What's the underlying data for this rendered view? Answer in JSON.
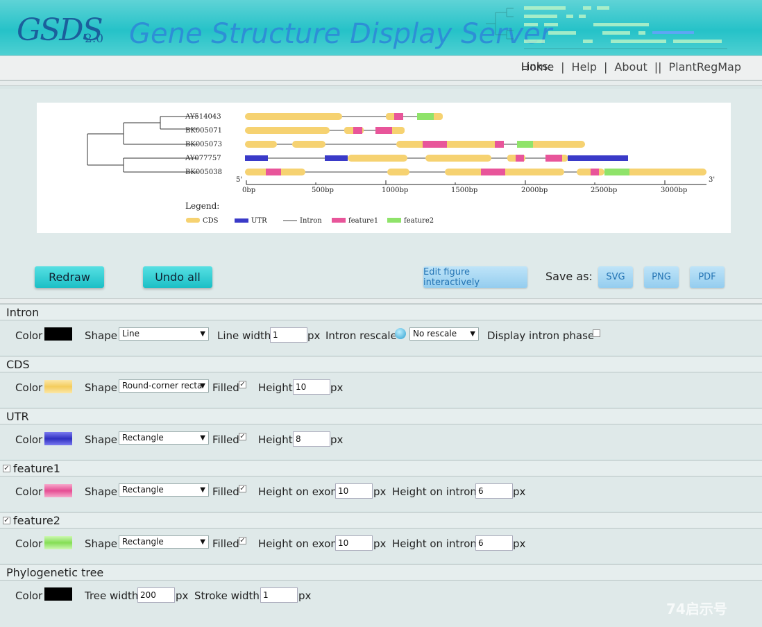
{
  "header": {
    "logo_text": "GSDS",
    "logo_version": "2.0",
    "title": "Gene Structure Display Server"
  },
  "nav": {
    "home": "Home",
    "help": "Help",
    "about": "About",
    "links_label": "Links:",
    "plantregmap": "PlantRegMap",
    "sep1": "|",
    "sep2": "|",
    "sep3": "||"
  },
  "figure": {
    "genes": [
      "AY514043",
      "BK005071",
      "BK005073",
      "AY077757",
      "BK005038"
    ],
    "five_prime": "5'",
    "three_prime": "3'",
    "ticks": [
      "0bp",
      "500bp",
      "1000bp",
      "1500bp",
      "2000bp",
      "2500bp",
      "3000bp"
    ],
    "legend_title": "Legend:",
    "legend": [
      "CDS",
      "UTR",
      "Intron",
      "feature1",
      "feature2"
    ]
  },
  "actions": {
    "redraw": "Redraw",
    "undo_all": "Undo all",
    "edit_interactive": "Edit figure interactively",
    "save_as": "Save as:",
    "svg": "SVG",
    "png": "PNG",
    "pdf": "PDF"
  },
  "labels": {
    "color": "Color",
    "shape": "Shape",
    "filled": "Filled",
    "height": "Height",
    "px": "px",
    "line_width": "Line width",
    "intron_rescale": "Intron rescale",
    "display_intron_phase": "Display intron phase",
    "height_on_exon": "Height on exon",
    "height_on_intron": "Height on intron",
    "tree_width": "Tree width",
    "stroke_width": "Stroke width"
  },
  "sections": {
    "intron": {
      "title": "Intron",
      "color": "#000000",
      "shape": "Line",
      "line_width": "1",
      "rescale": "No rescale"
    },
    "cds": {
      "title": "CDS",
      "color": "#f6d271",
      "shape": "Round-corner recta",
      "height": "10"
    },
    "utr": {
      "title": "UTR",
      "color": "#3a3ac8",
      "shape": "Rectangle",
      "height": "8"
    },
    "feature1": {
      "title": "feature1",
      "color": "#e8559a",
      "shape": "Rectangle",
      "height_exon": "10",
      "height_intron": "6"
    },
    "feature2": {
      "title": "feature2",
      "color": "#8fe36a",
      "shape": "Rectangle",
      "height_exon": "10",
      "height_intron": "6"
    },
    "tree": {
      "title": "Phylogenetic tree",
      "color": "#000000",
      "tree_width": "200",
      "stroke_width": "1"
    }
  },
  "watermark": "74启示号"
}
